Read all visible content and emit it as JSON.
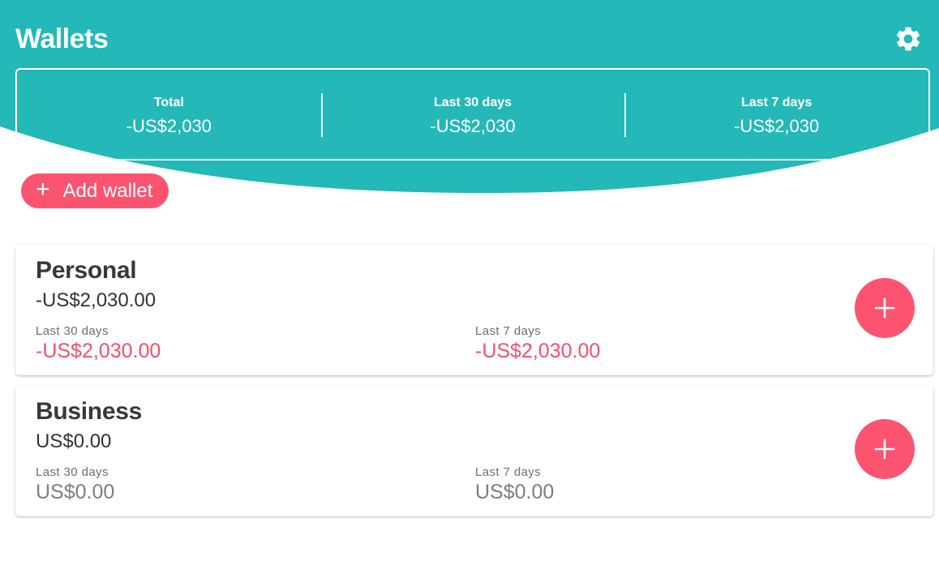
{
  "colors": {
    "header_teal": "#24b8b8",
    "accent_pink": "#fc5470",
    "negative_red": "#f2506d",
    "neutral_grey": "#7d7d7d"
  },
  "header": {
    "title": "Wallets",
    "settings_icon": "gear-icon"
  },
  "summary": {
    "total": {
      "label": "Total",
      "value": "-US$2,030"
    },
    "last30": {
      "label": "Last 30 days",
      "value": "-US$2,030"
    },
    "last7": {
      "label": "Last 7 days",
      "value": "-US$2,030"
    }
  },
  "add_wallet": {
    "icon": "plus-icon",
    "label": "Add wallet"
  },
  "wallets": [
    {
      "name": "Personal",
      "balance": "-US$2,030.00",
      "last30_label": "Last 30 days",
      "last30_value": "-US$2,030.00",
      "last7_label": "Last 7 days",
      "last7_value": "-US$2,030.00",
      "add_icon": "plus-icon"
    },
    {
      "name": "Business",
      "balance": "US$0.00",
      "last30_label": "Last 30 days",
      "last30_value": "US$0.00",
      "last7_label": "Last 7 days",
      "last7_value": "US$0.00",
      "add_icon": "plus-icon"
    }
  ]
}
